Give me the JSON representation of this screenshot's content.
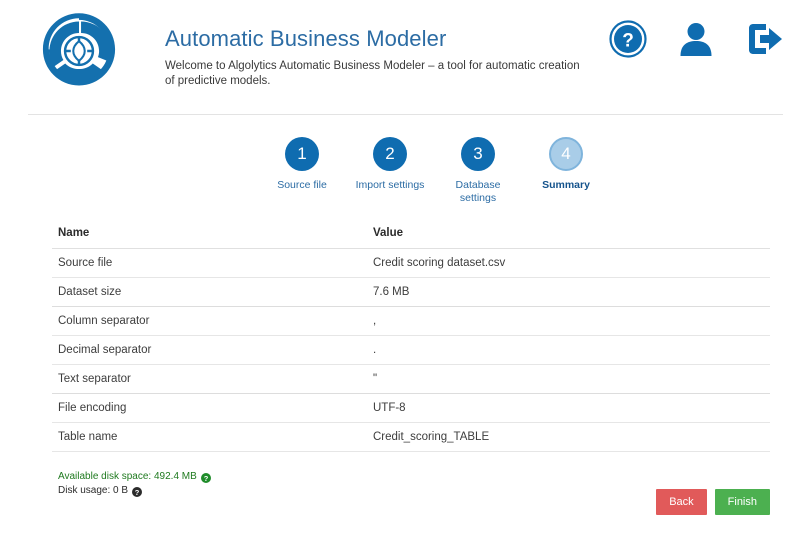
{
  "header": {
    "logo_icon": "algolytics-circular-logo",
    "title": "Automatic Business Modeler",
    "subtitle": "Welcome to Algolytics Automatic Business Modeler – a tool for automatic creation of predictive models.",
    "icons": [
      {
        "name": "help-icon",
        "label": "Help"
      },
      {
        "name": "user-icon",
        "label": "User account"
      },
      {
        "name": "logout-icon",
        "label": "Log out"
      }
    ]
  },
  "stepper": {
    "current_step": 4,
    "steps": [
      {
        "number": "1",
        "label": "Source file"
      },
      {
        "number": "2",
        "label": "Import settings"
      },
      {
        "number": "3",
        "label": "Database settings"
      },
      {
        "number": "4",
        "label": "Summary"
      }
    ]
  },
  "table": {
    "columns": [
      "Name",
      "Value"
    ],
    "rows": [
      {
        "name": "Source file",
        "value": "Credit scoring dataset.csv"
      },
      {
        "name": "Dataset size",
        "value": "7.6 MB"
      },
      {
        "name": "Column separator",
        "value": ","
      },
      {
        "name": "Decimal separator",
        "value": "."
      },
      {
        "name": "Text separator",
        "value": "\""
      },
      {
        "name": "File encoding",
        "value": "UTF-8"
      },
      {
        "name": "Table name",
        "value": "Credit_scoring_TABLE"
      }
    ]
  },
  "footer": {
    "available_disk_space": "Available disk space: 492.4 MB",
    "disk_usage": "Disk usage: 0 B",
    "available_help_icon": "help-circle-icon",
    "usage_help_icon": "help-circle-icon",
    "back_label": "Back",
    "finish_label": "Finish"
  },
  "colors": {
    "brand_blue": "#0f6cb0",
    "title_blue": "#2c6ca4",
    "step_current": "#a9cde8",
    "back_red": "#e15a5a",
    "finish_green": "#4cb050",
    "disk_green": "#1f7a1f"
  }
}
